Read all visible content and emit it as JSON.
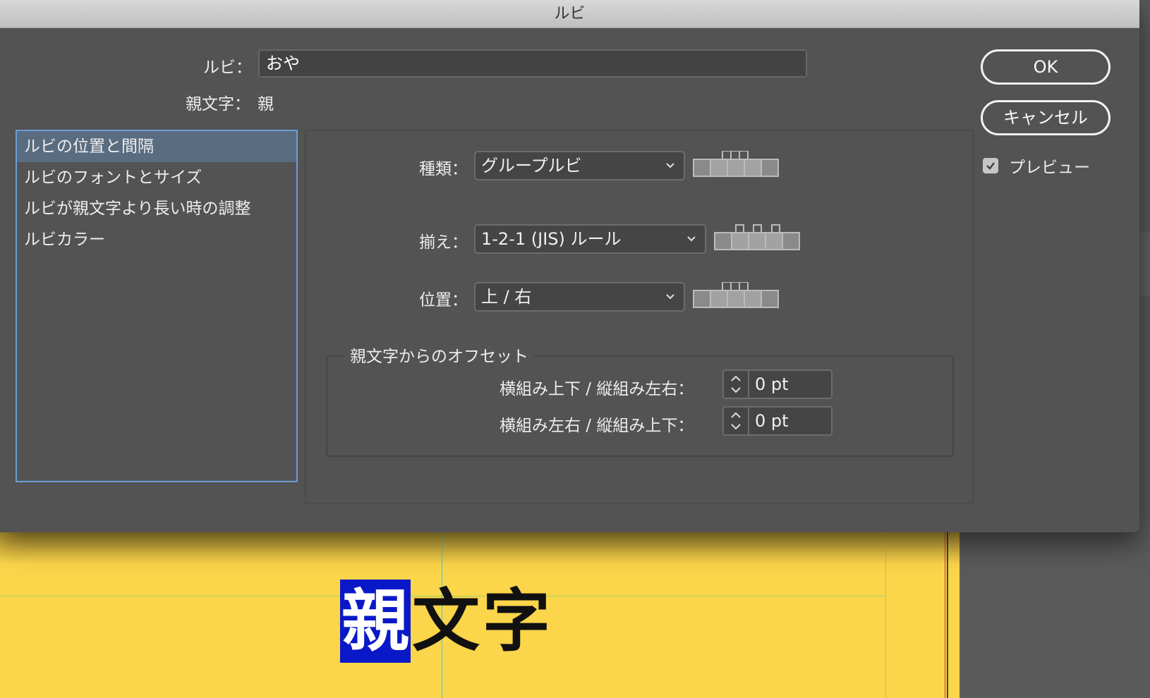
{
  "window": {
    "title": "ルビ"
  },
  "ruby": {
    "label": "ルビ：",
    "value": "おや"
  },
  "base": {
    "label": "親文字：",
    "value": "親"
  },
  "categories": [
    {
      "label": "ルビの位置と間隔",
      "selected": true
    },
    {
      "label": "ルビのフォントとサイズ",
      "selected": false
    },
    {
      "label": "ルビが親文字より長い時の調整",
      "selected": false
    },
    {
      "label": "ルビカラー",
      "selected": false
    }
  ],
  "settings": {
    "type": {
      "label": "種類：",
      "value": "グループルビ",
      "icon": "group-ruby-glyph"
    },
    "align": {
      "label": "揃え：",
      "value": "1-2-1 (JIS) ルール",
      "icon": "jis-121-rule-glyph"
    },
    "position": {
      "label": "位置：",
      "value": "上 / 右",
      "icon": "above-right-glyph"
    }
  },
  "offset": {
    "title": "親文字からのオフセット",
    "x_label": "横組み上下 / 縦組み左右：",
    "x_value": "0 pt",
    "y_label": "横組み左右 / 縦組み上下：",
    "y_value": "0 pt"
  },
  "buttons": {
    "ok": "OK",
    "cancel": "キャンセル"
  },
  "preview": {
    "label": "プレビュー",
    "checked": true
  },
  "document": {
    "chars": [
      "親",
      "文",
      "字"
    ],
    "highlight_color": "#0a19c8",
    "page_color": "#fbd54a"
  }
}
